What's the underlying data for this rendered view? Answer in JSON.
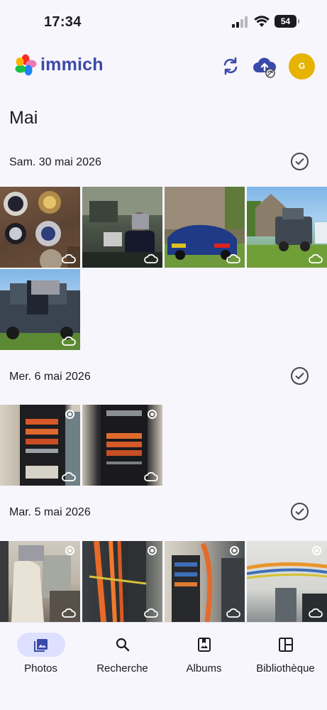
{
  "status_bar": {
    "time": "17:34",
    "battery": "54"
  },
  "app": {
    "name": "immich",
    "avatar_initial": "G"
  },
  "month_title": "Mai",
  "groups": [
    {
      "date": "Sam. 30 mai 2026",
      "photo_count": 5
    },
    {
      "date": "Mer. 6 mai 2026",
      "photo_count": 2
    },
    {
      "date": "Mar. 5 mai 2026",
      "photo_count": 4
    }
  ],
  "icons": {
    "sync": "sync-icon",
    "backup": "cloud-upload-icon",
    "select": "check-circle-icon",
    "cloud": "cloud-icon",
    "live": "live-photo-icon"
  },
  "nav": {
    "items": [
      {
        "label": "Photos",
        "icon": "photos-icon",
        "active": true
      },
      {
        "label": "Recherche",
        "icon": "search-icon",
        "active": false
      },
      {
        "label": "Albums",
        "icon": "albums-icon",
        "active": false
      },
      {
        "label": "Bibliothèque",
        "icon": "library-icon",
        "active": false
      }
    ]
  },
  "colors": {
    "accent": "#3a4aa8",
    "avatar": "#e6b300",
    "nav_active_pill": "#dde1ff",
    "background": "#f8f6fd"
  }
}
